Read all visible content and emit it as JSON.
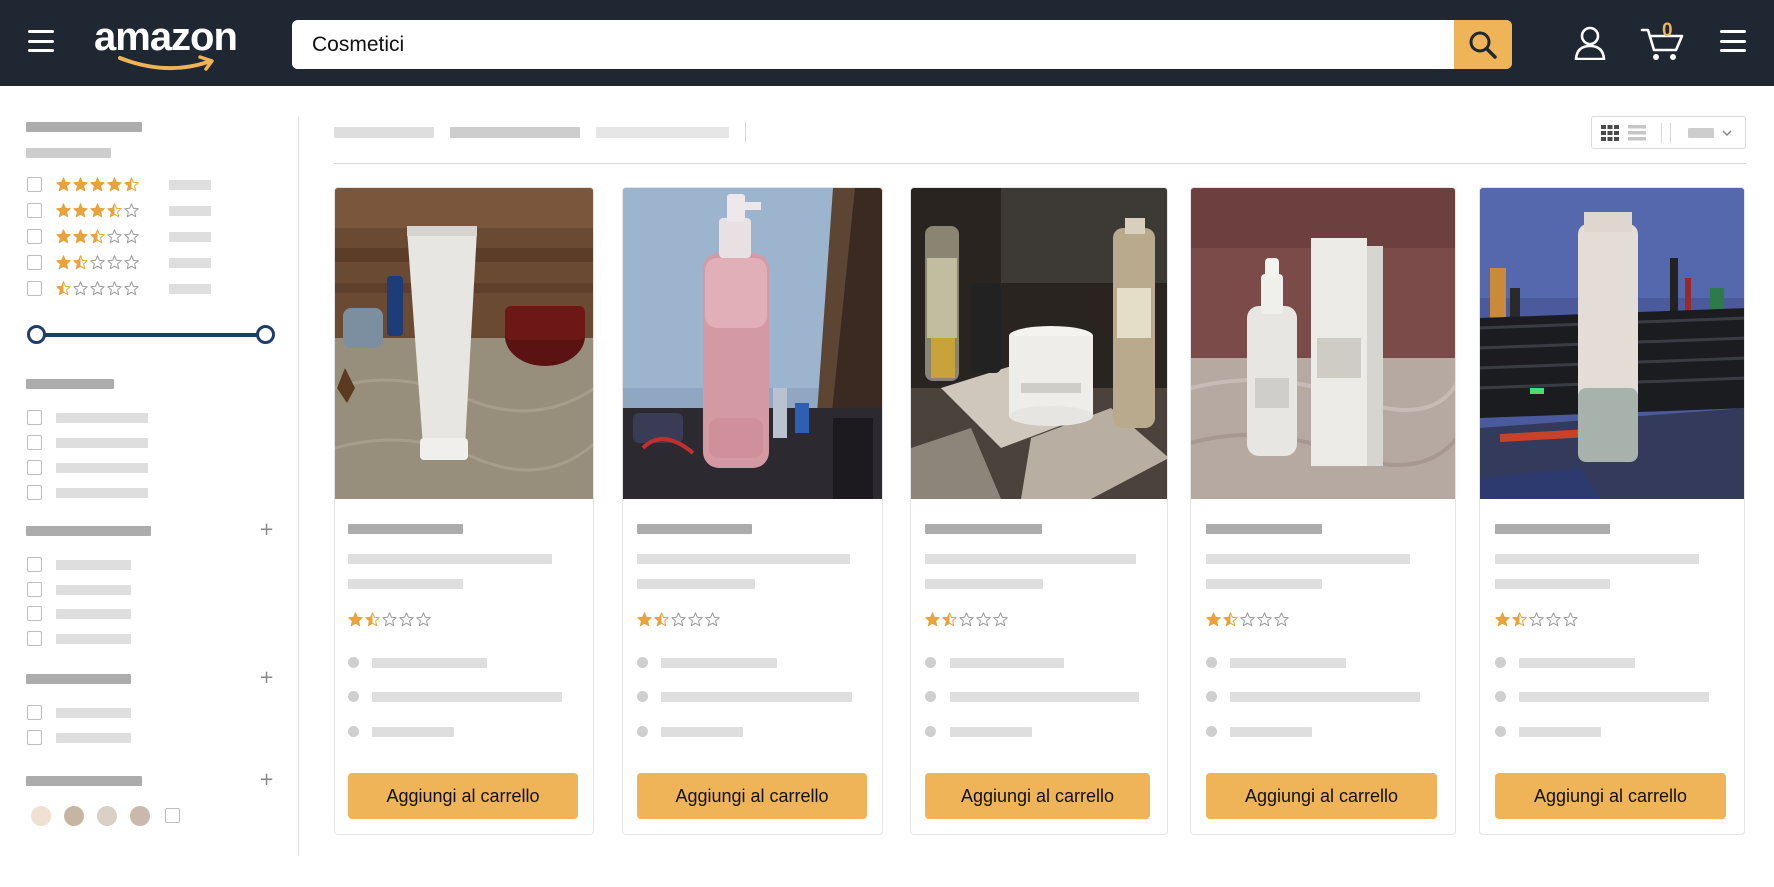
{
  "header": {
    "logo_text": "amazon",
    "search": {
      "value": "Cosmetici",
      "placeholder": ""
    },
    "cart_count": "0",
    "icons": [
      "menu-icon",
      "search-icon",
      "account-icon",
      "cart-icon",
      "menu-icon"
    ]
  },
  "colors": {
    "header_bg": "#1f2733",
    "accent": "#eeb457",
    "slider": "#1f3d6b",
    "star": "#e8a33c"
  },
  "filters": {
    "rating_options": [
      4.5,
      3.5,
      2.5,
      1.5,
      0.5
    ],
    "price_slider": {
      "min": 0,
      "max": 1
    },
    "color_swatches": [
      "#efe1d2",
      "#c6b5a3",
      "#dbd0c5",
      "#cab8aa"
    ]
  },
  "products": [
    {
      "rating": 1.5,
      "button_label": "Aggiungi al carrello"
    },
    {
      "rating": 1.5,
      "button_label": "Aggiungi al carrello"
    },
    {
      "rating": 1.5,
      "button_label": "Aggiungi al carrello"
    },
    {
      "rating": 1.5,
      "button_label": "Aggiungi al carrello"
    },
    {
      "rating": 1.5,
      "button_label": "Aggiungi al carrello"
    }
  ]
}
